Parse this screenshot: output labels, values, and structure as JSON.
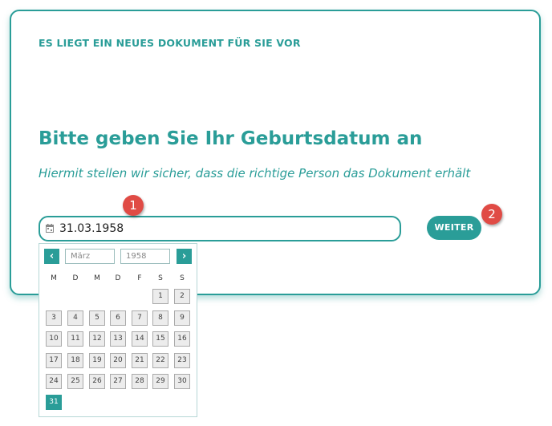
{
  "notice": "ES LIEGT EIN NEUES DOKUMENT FÜR SIE VOR",
  "heading": "Bitte geben Sie Ihr Geburtsdatum an",
  "subheading": "Hiermit stellen wir sicher, dass die richtige Person das Dokument erhält",
  "date_input": {
    "value": "31.03.1958",
    "icon": "calendar-icon"
  },
  "weiter_label": "WEITER",
  "markers": [
    "1",
    "2"
  ],
  "datepicker": {
    "prev_label": "‹",
    "next_label": "›",
    "month_placeholder": "März",
    "year_placeholder": "1958",
    "weekdays": [
      "M",
      "D",
      "M",
      "D",
      "F",
      "S",
      "S"
    ],
    "days": [
      "1",
      "2",
      "3",
      "4",
      "5",
      "6",
      "7",
      "8",
      "9",
      "10",
      "11",
      "12",
      "13",
      "14",
      "15",
      "16",
      "17",
      "18",
      "19",
      "20",
      "21",
      "22",
      "23",
      "24",
      "25",
      "26",
      "27",
      "28",
      "29",
      "30",
      "31"
    ],
    "selected_day": "31"
  },
  "colors": {
    "accent": "#2a9d98",
    "marker": "#e04b45"
  }
}
